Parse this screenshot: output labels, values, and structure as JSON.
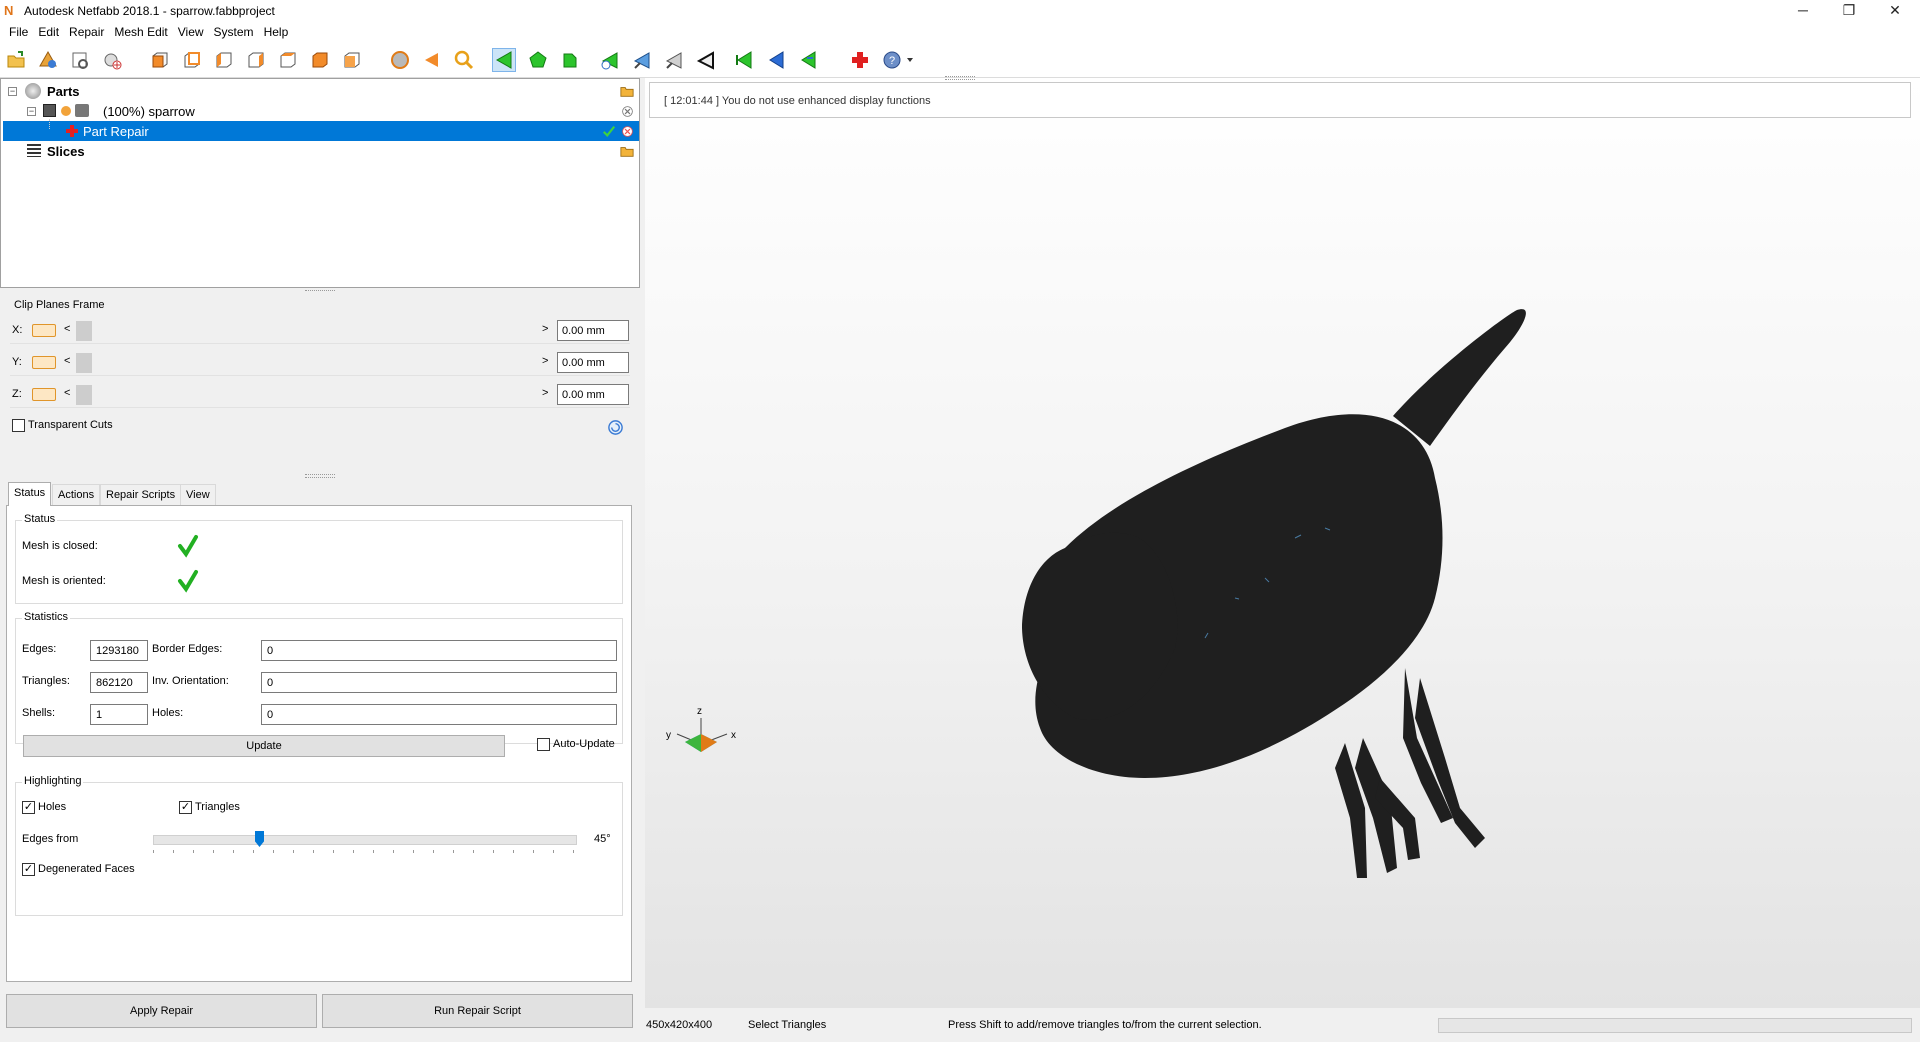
{
  "window": {
    "title": "Autodesk Netfabb 2018.1 - sparrow.fabbproject",
    "app_icon": "N",
    "controls": [
      "─",
      "❐",
      "✕"
    ]
  },
  "menu": [
    "File",
    "Edit",
    "Repair",
    "Mesh Edit",
    "View",
    "System",
    "Help"
  ],
  "tree": {
    "parts_label": "Parts",
    "part_label": "(100%) sparrow",
    "repair_label": "Part Repair",
    "slices_label": "Slices"
  },
  "clip_planes": {
    "title": "Clip Planes Frame",
    "rows": [
      {
        "axis": "X:",
        "value": "0.00 mm"
      },
      {
        "axis": "Y:",
        "value": "0.00 mm"
      },
      {
        "axis": "Z:",
        "value": "0.00 mm"
      }
    ],
    "transparent_cuts_label": "Transparent Cuts",
    "transparent_cuts_checked": false
  },
  "tabs": [
    "Status",
    "Actions",
    "Repair Scripts",
    "View"
  ],
  "status_group": {
    "title": "Status",
    "mesh_closed_label": "Mesh is closed:",
    "mesh_oriented_label": "Mesh is oriented:"
  },
  "statistics": {
    "title": "Statistics",
    "edges_label": "Edges:",
    "edges_value": "1293180",
    "border_edges_label": "Border Edges:",
    "border_edges_value": "0",
    "triangles_label": "Triangles:",
    "triangles_value": "862120",
    "inv_orientation_label": "Inv. Orientation:",
    "inv_orientation_value": "0",
    "shells_label": "Shells:",
    "shells_value": "1",
    "holes_label": "Holes:",
    "holes_value": "0",
    "update_label": "Update",
    "auto_update_label": "Auto-Update",
    "auto_update_checked": false
  },
  "highlighting": {
    "title": "Highlighting",
    "holes_label": "Holes",
    "holes_checked": true,
    "triangles_label": "Triangles",
    "triangles_checked": true,
    "edges_from_label": "Edges from",
    "edges_from_value": "45°",
    "edges_from_fraction": 0.25,
    "degenerated_label": "Degenerated Faces",
    "degenerated_checked": true
  },
  "buttons": {
    "apply_repair": "Apply Repair",
    "run_repair_script": "Run Repair Script"
  },
  "log_message": "[ 12:01:44 ] You do not use enhanced display functions",
  "axis_labels": {
    "z": "z",
    "y": "y",
    "x": "x"
  },
  "statusbar": {
    "dimensions": "450x420x400",
    "mode": "Select Triangles",
    "hint": "Press Shift to add/remove triangles to/from the current selection."
  },
  "colors": {
    "selection": "#0078d7",
    "model": "#1f1f1f",
    "clip_swatch": "#e0952a",
    "check_green": "#2fb52f"
  }
}
